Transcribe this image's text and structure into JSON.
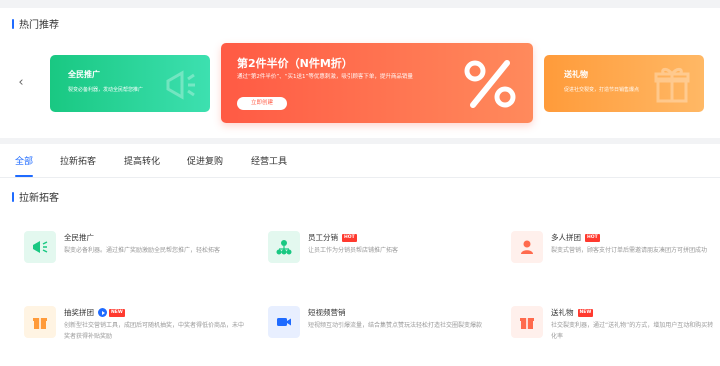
{
  "hot": {
    "title": "热门推荐",
    "cards": {
      "left": {
        "title": "全民推广",
        "desc": "裂变必备利器，发动全民帮您推广"
      },
      "center": {
        "title": "第2件半价（N件M折）",
        "desc": "通过“第2件半价”、“买1送1”等优惠刺激，吸引顾客下单，提升商品销量",
        "button": "立即创建"
      },
      "right": {
        "title": "送礼物",
        "desc": "促进社交裂变，打造节日销售爆点"
      }
    }
  },
  "tabs": [
    "全部",
    "拉新拓客",
    "提高转化",
    "促进复购",
    "经营工具"
  ],
  "section": {
    "title": "拉新拓客",
    "tools": [
      {
        "name": "全民推广",
        "desc": "裂变必备利器。通过推广奖励激励全民帮您推广，轻松拓客",
        "badge": ""
      },
      {
        "name": "员工分销",
        "desc": "让员工作为分销员帮店铺推广拓客",
        "badge": "HOT"
      },
      {
        "name": "多人拼团",
        "desc": "裂变式营销，顾客支付订单后需邀请朋友凑团方可拼团成功",
        "badge": "HOT"
      },
      {
        "name": "抽奖拼团",
        "desc": "创新型社交营销工具，成团后可随机抽奖，中奖者得低价商品，未中奖者获得补贴奖励",
        "badge": "NEW"
      },
      {
        "name": "短视频营销",
        "desc": "短视频互动引爆流量，结合集赞点赞玩法轻松打造社交圈裂变爆款",
        "badge": ""
      },
      {
        "name": "送礼物",
        "desc": "社交裂变利器，通过“送礼物”的方式，增加用户互动和购买转化率",
        "badge": "NEW"
      }
    ]
  },
  "colors": {
    "accent": "#1f6bff",
    "hot": "#ff3a2f",
    "green": "#19c882",
    "red": "#ff5a44",
    "orange": "#ff9b3a"
  }
}
